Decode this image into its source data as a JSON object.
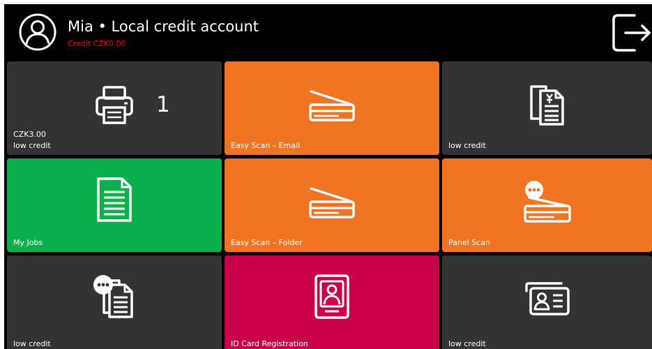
{
  "header": {
    "title": "Mia • Local credit account",
    "credit": "Credit CZK0.00",
    "avatar_icon": "user-avatar-icon",
    "logout_icon": "logout-icon"
  },
  "colors": {
    "background": "#000000",
    "tile_dark": "#333333",
    "tile_orange": "#f07422",
    "tile_green": "#0cb04a",
    "tile_crimson": "#c8004a",
    "credit_red": "#e60012"
  },
  "tiles": [
    {
      "id": "print",
      "icon": "printer-icon",
      "count": "1",
      "sublabel": "CZK3.00",
      "label": "low credit",
      "color": "#333333"
    },
    {
      "id": "easy-scan-email",
      "icon": "scanner-icon",
      "label": "Easy Scan – Email",
      "color": "#f07422"
    },
    {
      "id": "copy",
      "icon": "copy-documents-icon",
      "label": "low credit",
      "color": "#333333"
    },
    {
      "id": "my-jobs",
      "icon": "document-icon",
      "label": "My Jobs",
      "color": "#0cb04a"
    },
    {
      "id": "easy-scan-folder",
      "icon": "scanner-icon",
      "label": "Easy Scan – Folder",
      "color": "#f07422"
    },
    {
      "id": "panel-scan",
      "icon": "panel-scanner-icon",
      "label": "Panel Scan",
      "color": "#f07422"
    },
    {
      "id": "panel-copy",
      "icon": "documents-menu-icon",
      "label": "low credit",
      "color": "#333333"
    },
    {
      "id": "id-card-registration",
      "icon": "id-badge-icon",
      "label": "ID Card Registration",
      "color": "#c8004a"
    },
    {
      "id": "id-card-copy",
      "icon": "id-card-icon",
      "label": "low credit",
      "color": "#333333"
    }
  ]
}
